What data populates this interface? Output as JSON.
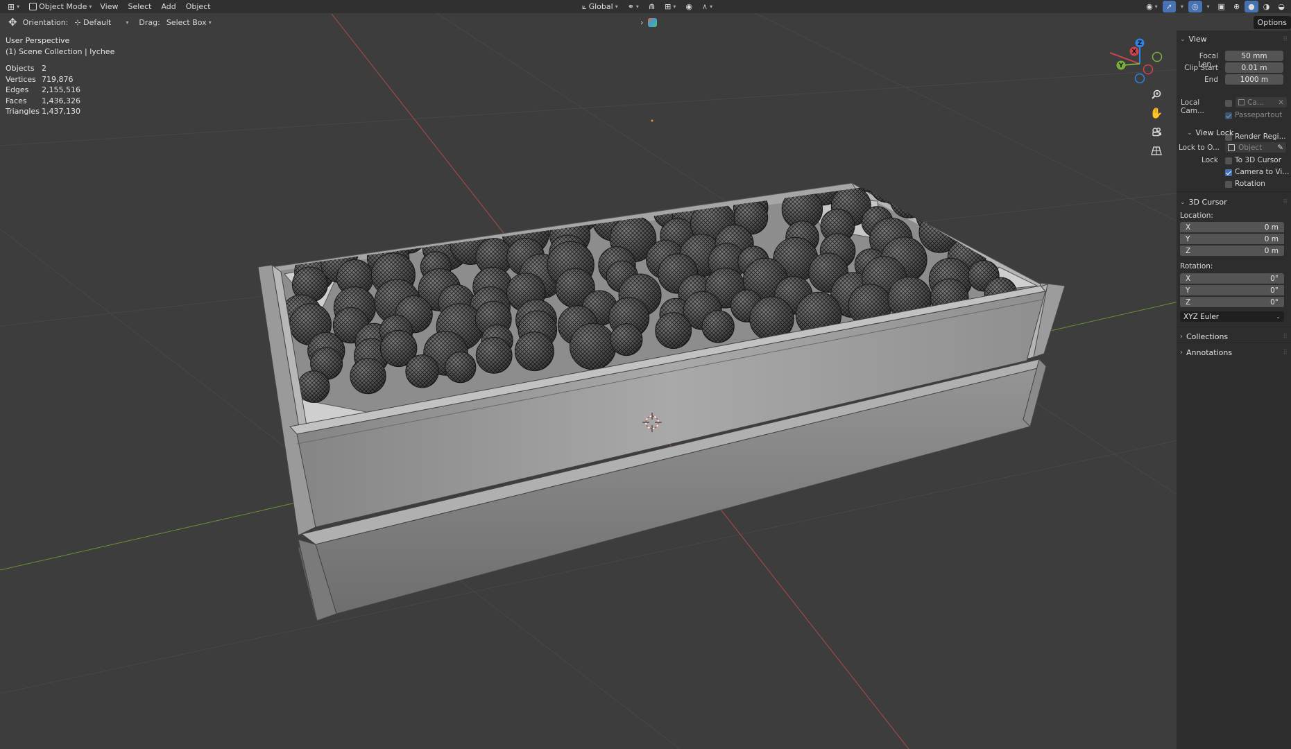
{
  "header": {
    "mode": "Object Mode",
    "menus": [
      "View",
      "Select",
      "Add",
      "Object"
    ],
    "transform_orientation": "Global"
  },
  "toolbar": {
    "orientation_label": "Orientation:",
    "orientation_value": "Default",
    "drag_label": "Drag:",
    "drag_value": "Select Box",
    "options_label": "Options"
  },
  "overlay": {
    "perspective": "User Perspective",
    "collection": "(1) Scene Collection | lychee",
    "stats": [
      {
        "label": "Objects",
        "value": "2"
      },
      {
        "label": "Vertices",
        "value": "719,876"
      },
      {
        "label": "Edges",
        "value": "2,155,516"
      },
      {
        "label": "Faces",
        "value": "1,436,326"
      },
      {
        "label": "Triangles",
        "value": "1,437,130"
      }
    ]
  },
  "gizmo": {
    "x": "X",
    "y": "Y",
    "z": "Z"
  },
  "sidebar": {
    "view": {
      "title": "View",
      "focal_length_label": "Focal Len...",
      "focal_length": "50 mm",
      "clip_start_label": "Clip Start",
      "clip_start": "0.01 m",
      "clip_end_label": "End",
      "clip_end": "1000 m",
      "local_camera_label": "Local Cam...",
      "local_camera_value": "Ca...",
      "passepartout": "Passepartout",
      "render_region": "Render Regi..."
    },
    "view_lock": {
      "title": "View Lock",
      "lock_to_object_label": "Lock to O...",
      "lock_to_object_placeholder": "Object",
      "lock_label": "Lock",
      "to_3d_cursor": "To 3D Cursor",
      "camera_to_view": "Camera to Vi...",
      "rotation": "Rotation"
    },
    "cursor": {
      "title": "3D Cursor",
      "location_label": "Location:",
      "location": [
        {
          "axis": "X",
          "value": "0 m"
        },
        {
          "axis": "Y",
          "value": "0 m"
        },
        {
          "axis": "Z",
          "value": "0 m"
        }
      ],
      "rotation_label": "Rotation:",
      "rotation": [
        {
          "axis": "X",
          "value": "0°"
        },
        {
          "axis": "Y",
          "value": "0°"
        },
        {
          "axis": "Z",
          "value": "0°"
        }
      ],
      "rotation_mode": "XYZ Euler"
    },
    "collections": "Collections",
    "annotations": "Annotations"
  },
  "colors": {
    "viewport_bg": "#3d3d3d",
    "header_bg": "#303030",
    "sidebar_bg": "#2d2d2d",
    "field_bg": "#545454",
    "accent": "#4772b3",
    "axis_x": "#d0434d",
    "axis_y": "#79b13a",
    "axis_z": "#2f83e3"
  }
}
